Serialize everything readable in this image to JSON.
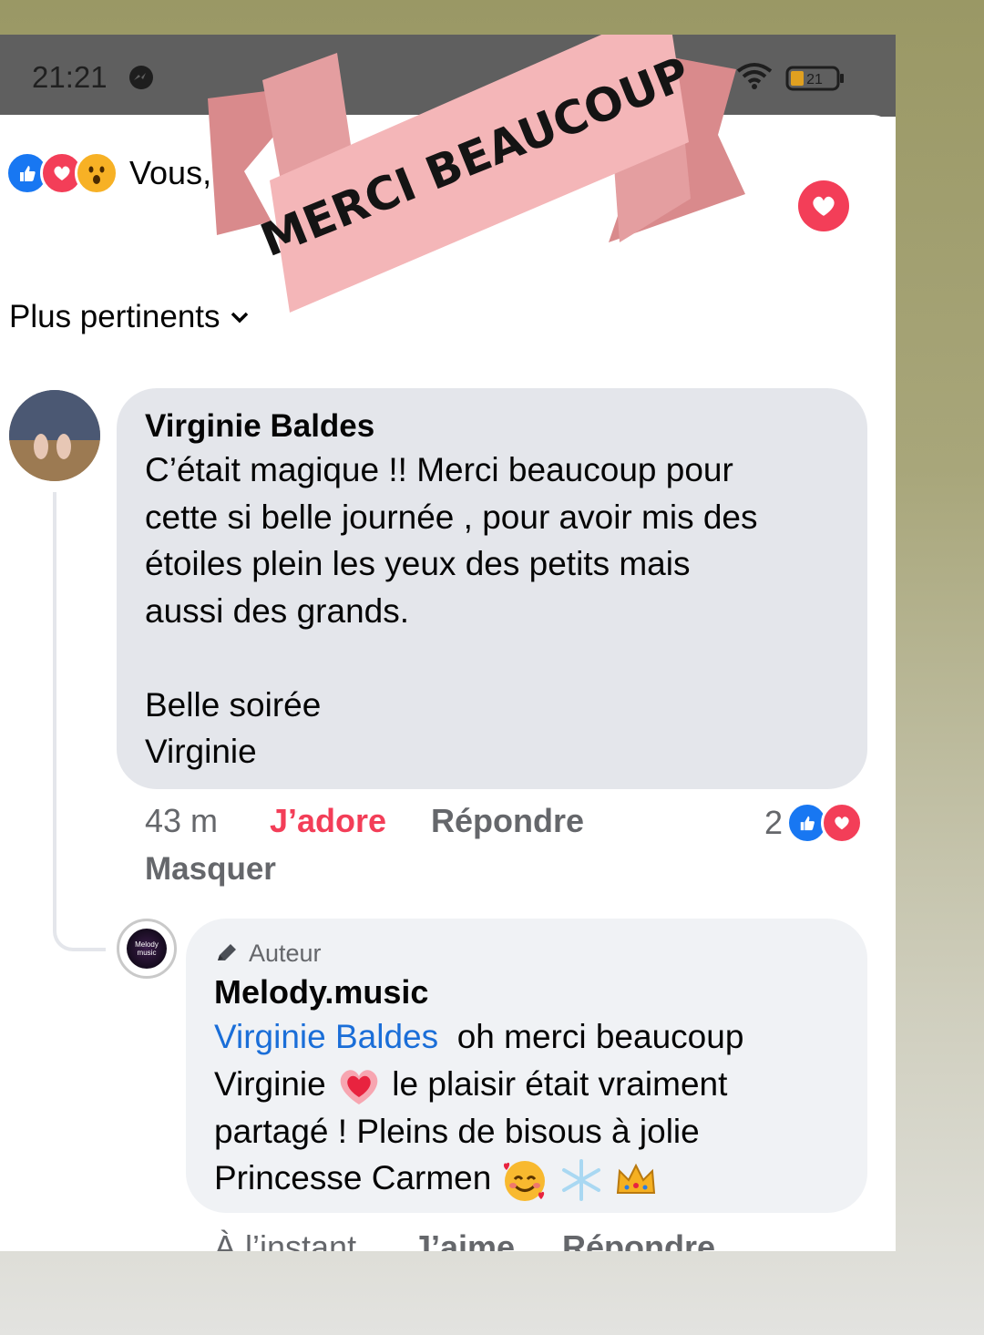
{
  "status_bar": {
    "time": "21:21",
    "battery": "21",
    "icons": [
      "messenger-icon",
      "wifi-icon",
      "battery-icon"
    ]
  },
  "banner": {
    "text": "MERCI BEAUCOUP",
    "color": "#f4b6b8"
  },
  "reactions": {
    "icons": [
      "like-icon",
      "love-icon",
      "wow-icon"
    ],
    "text": "Vous, L"
  },
  "sort": {
    "label": "Plus pertinents"
  },
  "comment": {
    "author": "Virginie Baldes",
    "text": "C’était magique !! Merci beaucoup pour\ncette si belle journée , pour avoir mis des\nétoiles plein les yeux des petits mais\naussi des grands.\n\nBelle soirée\nVirginie",
    "time": "43 m",
    "like_label": "J’adore",
    "reply_label": "Répondre",
    "reaction_count": "2",
    "hide_label": "Masquer"
  },
  "reply": {
    "badge": "Auteur",
    "author": "Melody.music",
    "avatar_text": "Melody music",
    "mention": "Virginie Baldes",
    "text_line1": "oh merci beaucoup",
    "text_line2a": "Virginie",
    "text_line2b": "le plaisir était vraiment",
    "text_line3": "partagé ! Pleins de bisous à jolie",
    "text_line4": "Princesse Carmen",
    "time": "À l’instant",
    "like_label": "J’aime",
    "reply_label": "Répondre"
  },
  "colors": {
    "accent_love": "#f33e58",
    "accent_like": "#1877f2",
    "mention": "#1a6ed8",
    "bubble_gray": "#e4e6eb",
    "secondary_text": "#65676b"
  }
}
